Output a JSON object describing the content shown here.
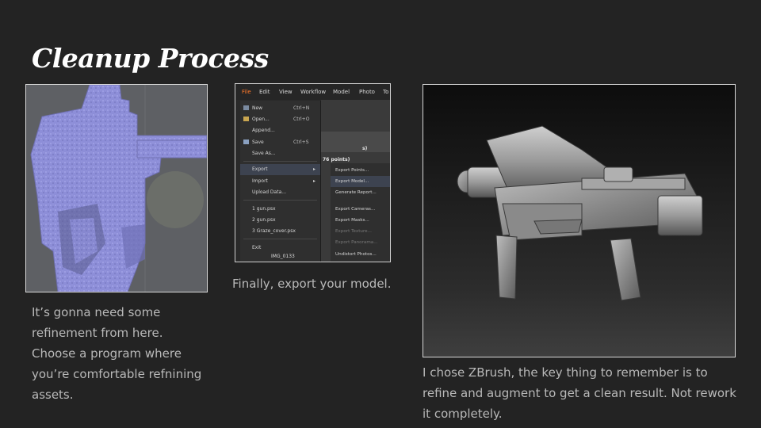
{
  "slide": {
    "title": "Cleanup Process",
    "caption_left": "It’s gonna need some refinement from here. Choose a program where you’re comfortable refnining assets.",
    "caption_middle": "Finally, export your model.",
    "caption_right": "I chose ZBrush, the key thing to remember is to refine and augment to get a clean result. Not rework it completely."
  },
  "menu_screenshot": {
    "menubar": [
      "File",
      "Edit",
      "View",
      "Workflow",
      "Model",
      "Photo",
      "To"
    ],
    "file_menu": [
      {
        "label": "New",
        "shortcut": "Ctrl+N"
      },
      {
        "label": "Open...",
        "shortcut": "Ctrl+O"
      },
      {
        "label": "Append...",
        "shortcut": ""
      },
      {
        "label": "Save",
        "shortcut": "Ctrl+S"
      },
      {
        "label": "Save As...",
        "shortcut": ""
      },
      {
        "label": "Export",
        "shortcut": ""
      },
      {
        "label": "Import",
        "shortcut": ""
      },
      {
        "label": "Upload Data...",
        "shortcut": ""
      },
      {
        "label": "1 gun.psx",
        "shortcut": ""
      },
      {
        "label": "2 gun.psx",
        "shortcut": ""
      },
      {
        "label": "3 Graze_cover.psx",
        "shortcut": ""
      },
      {
        "label": "Exit",
        "shortcut": ""
      }
    ],
    "export_submenu": [
      "Export Points...",
      "Export Model...",
      "Generate Report...",
      "Export Cameras...",
      "Export Masks...",
      "Export Texture...",
      "Export Panorama...",
      "Undistort Photos..."
    ],
    "background_fragments": [
      "s)",
      "76 points)",
      "IMG_0133"
    ]
  },
  "colors": {
    "background": "#232323",
    "title": "#ffffff",
    "caption": "#b9b9b9",
    "mesh": "#8f8fd8",
    "menu_active": "#ff7a2a"
  }
}
